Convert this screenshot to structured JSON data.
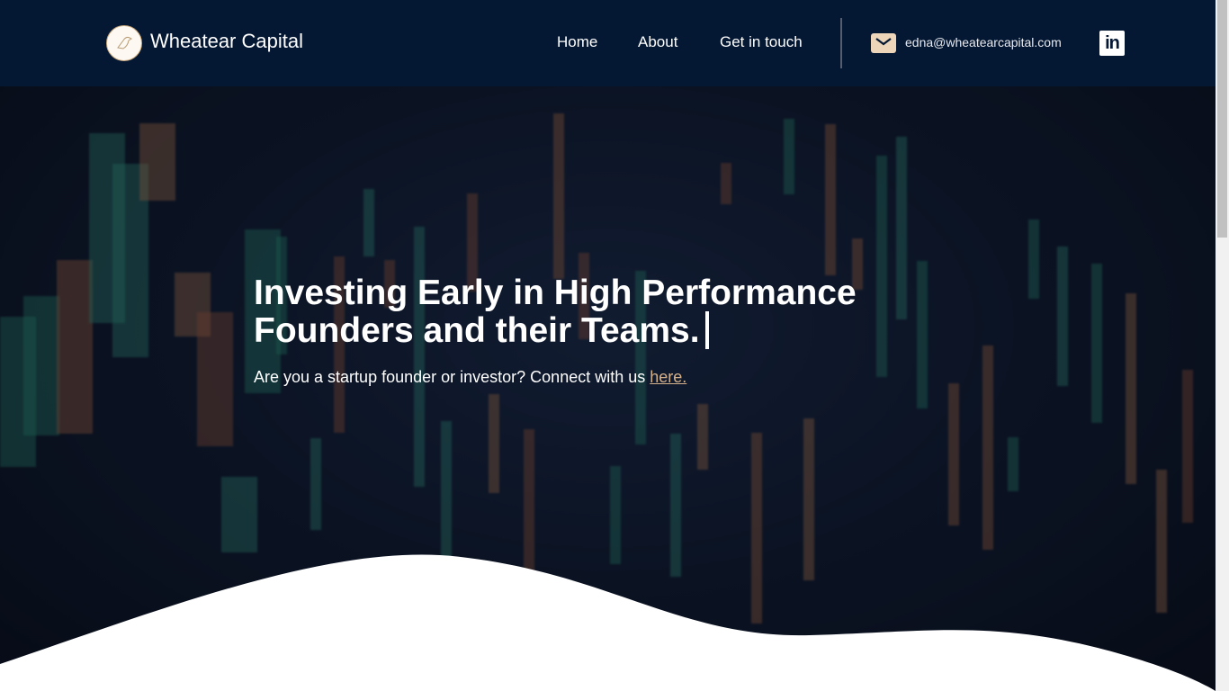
{
  "header": {
    "brand": "Wheatear Capital",
    "nav": [
      {
        "label": "Home"
      },
      {
        "label": "About"
      },
      {
        "label": "Get in touch"
      }
    ],
    "email": "edna@wheatearcapital.com",
    "icons": {
      "mail": "mail-icon",
      "social": "linkedin-icon"
    },
    "linkedin_glyph": "in"
  },
  "hero": {
    "title_line1": "Investing Early in High Performance",
    "title_line2": "Founders and their Teams.",
    "subtitle": "Are you a startup founder or investor? Connect with us ",
    "link": "here."
  },
  "colors": {
    "header_bg": "#041733",
    "accent": "#d6b28c",
    "mail_icon": "#ecd5b8"
  }
}
